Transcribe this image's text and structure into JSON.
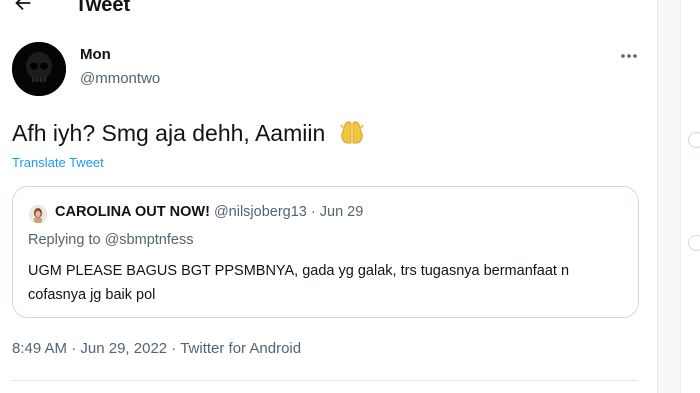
{
  "header": {
    "title": "Tweet"
  },
  "author": {
    "name": "Mon",
    "handle": "@mmontwo"
  },
  "tweet": {
    "text": "Afh iyh? Smg aja dehh, Aamiin",
    "translate_label": "Translate Tweet"
  },
  "quote": {
    "name": "CAROLINA OUT NOW!",
    "handle": "@nilsjoberg13",
    "separator": " · ",
    "date": "Jun 29",
    "replying_prefix": "Replying to ",
    "replying_to": "@sbmptnfess",
    "text": "UGM PLEASE BAGUS BGT PPSMBNYA, gada yg galak, trs tugasnya bermanfaat n cofasnya jg baik pol"
  },
  "meta": {
    "time": "8:49 AM",
    "sep1": " · ",
    "date": "Jun 29, 2022",
    "sep2": " · ",
    "source": "Twitter for Android"
  },
  "icons": {
    "back": "back-arrow-icon",
    "more": "more-options-icon",
    "emoji": "folded-hands-emoji-icon"
  },
  "colors": {
    "link": "#1d9bf0",
    "secondary": "#536471",
    "border": "#cfd9de",
    "text": "#0f1419"
  }
}
